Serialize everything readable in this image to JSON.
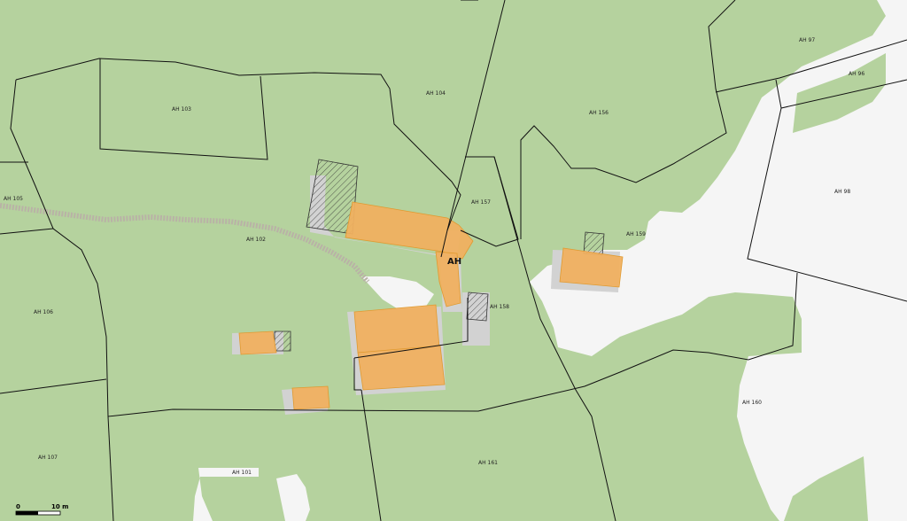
{
  "map": {
    "colors": {
      "background": "#f5f5f5",
      "forest": "#b5d29e",
      "building": "#f0b060",
      "building_outline": "#e09a30",
      "footprint": "#d2d2d2",
      "boundary": "#111111",
      "track": "#b9b2a6"
    },
    "place_label": "AH",
    "parcels": [
      "AH 97",
      "AH 96",
      "AH 104",
      "AH 156",
      "AH 103",
      "AH 98",
      "AH 105",
      "AH 157",
      "AH 102",
      "AH 159",
      "AH 158",
      "AH 106",
      "AH 160",
      "AH 107",
      "AH 161",
      "AH 101"
    ],
    "scale_bar": {
      "start": "0",
      "end": "10 m"
    }
  }
}
